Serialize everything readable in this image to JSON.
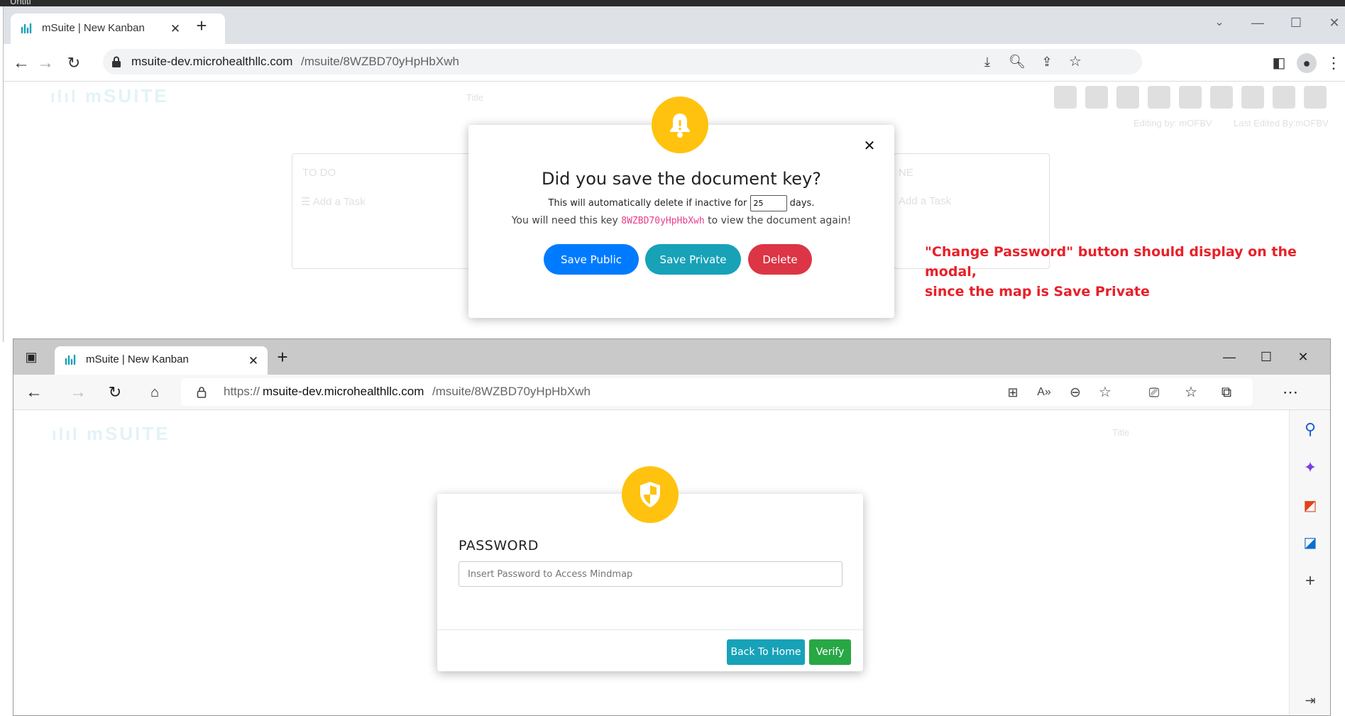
{
  "top_window": {
    "os_title": "Untitl",
    "tab_title": "mSuite | New Kanban",
    "url_domain": "msuite-dev.microhealthllc.com",
    "url_path": "/msuite/8WZBD70yHpHbXwh",
    "background": {
      "logo_text": "mSUITE",
      "title_placeholder": "Title",
      "editing_by": "Editing by: mOFBV",
      "last_edited_by": "Last Edited By:mOFBV",
      "column_todo": "TO DO",
      "column_done": "NE",
      "add_task": "Add a Task"
    },
    "modal": {
      "heading": "Did you save the document key?",
      "auto_delete_prefix": "This will automatically delete if inactive for",
      "inactive_days": "25",
      "auto_delete_suffix": "days.",
      "key_prefix": "You will need this key",
      "document_key": "8WZBD70yHpHbXwh",
      "key_suffix": "to view the document again!",
      "save_public_label": "Save Public",
      "save_private_label": "Save Private",
      "delete_label": "Delete"
    }
  },
  "annotation": {
    "line1": "\"Change Password\" button should display on the modal,",
    "line2": "since the map is Save Private"
  },
  "bottom_window": {
    "tab_title": "mSuite | New Kanban",
    "url_scheme": "https://",
    "url_domain": "msuite-dev.microhealthllc.com",
    "url_path": "/msuite/8WZBD70yHpHbXwh",
    "background": {
      "logo_text": "mSUITE",
      "title_placeholder": "Title"
    },
    "password_modal": {
      "label": "PASSWORD",
      "input_placeholder": "Insert Password to Access Mindmap",
      "back_home_label": "Back To Home",
      "verify_label": "Verify"
    }
  },
  "colors": {
    "primary_blue": "#007bff",
    "teal": "#17a2b8",
    "danger_red": "#dc3545",
    "success_green": "#28a745",
    "warning_yellow": "#ffc20e",
    "key_pink": "#e83e8c",
    "annotation_red": "#e8202a"
  }
}
